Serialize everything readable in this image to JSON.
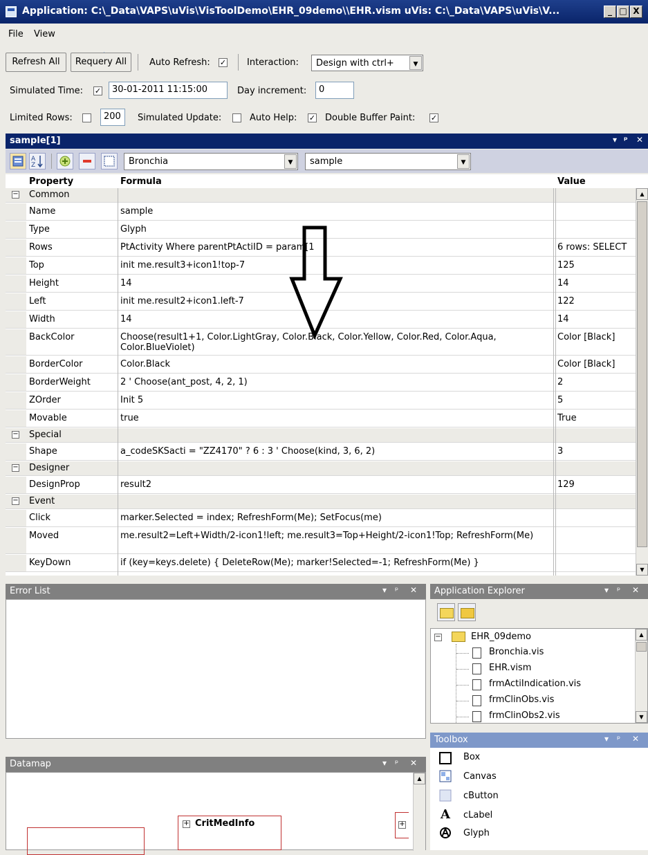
{
  "window": {
    "title": "Application: C:\\_Data\\VAPS\\uVis\\VisToolDemo\\EHR_09demo\\\\EHR.vism    uVis: C:\\_Data\\VAPS\\uVis\\V...",
    "minimize": "_",
    "maximize": "□",
    "close": "X"
  },
  "menu": {
    "file": "File",
    "view": "View",
    "back_icon": "back-arrow-icon",
    "forward_icon": "redo-arrow-icon"
  },
  "toolbar": {
    "refresh_all": "Refresh All",
    "requery_all": "Requery All",
    "auto_refresh_label": "Auto Refresh:",
    "auto_refresh_checked": true,
    "interaction_label": "Interaction:",
    "interaction_value": "Design with ctrl+",
    "simulated_time_label": "Simulated Time:",
    "simulated_time_checked": true,
    "simulated_time_value": "30-01-2011 11:15:00",
    "day_increment_label": "Day increment:",
    "day_increment_value": "0",
    "limited_rows_label": "Limited Rows:",
    "limited_rows_checked": false,
    "limited_rows_value": "200",
    "simulated_update_label": "Simulated Update:",
    "simulated_update_checked": false,
    "auto_help_label": "Auto Help:",
    "auto_help_checked": true,
    "double_buffer_label": "Double Buffer Paint:",
    "double_buffer_checked": true
  },
  "properties_panel": {
    "title": "sample[1]",
    "form_select": "Bronchia",
    "object_select": "sample",
    "columns": {
      "property": "Property",
      "formula": "Formula",
      "value": "Value"
    },
    "rows": [
      {
        "kind": "category",
        "name": "Common"
      },
      {
        "kind": "prop",
        "name": "Name",
        "formula": "sample",
        "value": ""
      },
      {
        "kind": "prop",
        "name": "Type",
        "formula": "Glyph",
        "value": ""
      },
      {
        "kind": "prop",
        "name": "Rows",
        "formula": "PtActivity Where parentPtActiID = param[1",
        "value": "6 rows: SELECT"
      },
      {
        "kind": "prop",
        "name": "Top",
        "formula": "init me.result3+icon1!top-7",
        "value": "125"
      },
      {
        "kind": "prop",
        "name": "Height",
        "formula": "14",
        "value": "14"
      },
      {
        "kind": "prop",
        "name": "Left",
        "formula": "init me.result2+icon1.left-7",
        "value": "122"
      },
      {
        "kind": "prop",
        "name": "Width",
        "formula": "14",
        "value": "14"
      },
      {
        "kind": "prop",
        "name": "BackColor",
        "formula": "Choose(result1+1, Color.LightGray, Color.Black, Color.Yellow, Color.Red, Color.Aqua, Color.BlueViolet)",
        "value": "Color [Black]"
      },
      {
        "kind": "prop",
        "name": "BorderColor",
        "formula": "Color.Black",
        "value": "Color [Black]"
      },
      {
        "kind": "prop",
        "name": "BorderWeight",
        "formula": "2 ' Choose(ant_post, 4, 2, 1)",
        "value": "2"
      },
      {
        "kind": "prop",
        "name": "ZOrder",
        "formula": "Init 5",
        "value": "5"
      },
      {
        "kind": "prop",
        "name": "Movable",
        "formula": "true",
        "value": "True"
      },
      {
        "kind": "category",
        "name": "Special"
      },
      {
        "kind": "prop",
        "name": "Shape",
        "formula": "a_codeSKSacti = \"ZZ4170\" ? 6 : 3 ' Choose(kind, 3, 6, 2)",
        "value": "3"
      },
      {
        "kind": "category",
        "name": "Designer"
      },
      {
        "kind": "prop",
        "name": "DesignProp",
        "formula": "result2",
        "value": "129"
      },
      {
        "kind": "category",
        "name": "Event"
      },
      {
        "kind": "prop",
        "name": "Click",
        "formula": "marker.Selected = index; RefreshForm(Me); SetFocus(me)",
        "value": ""
      },
      {
        "kind": "prop",
        "name": "Moved",
        "formula": "me.result2=Left+Width/2-icon1!left; me.result3=Top+Height/2-icon1!Top; RefreshForm(Me)",
        "value": ""
      },
      {
        "kind": "prop",
        "name": "KeyDown",
        "formula": "if (key=keys.delete) { DeleteRow(Me); marker!Selected=-1; RefreshForm(Me) }",
        "value": ""
      }
    ]
  },
  "error_list": {
    "title": "Error List"
  },
  "app_explorer": {
    "title": "Application Explorer",
    "root": "EHR_09demo",
    "files": [
      "Bronchia.vis",
      "EHR.vism",
      "frmActiIndication.vis",
      "frmClinObs.vis",
      "frmClinObs2.vis"
    ]
  },
  "toolbox": {
    "title": "Toolbox",
    "items": [
      {
        "label": "Box",
        "icon": "box-icon"
      },
      {
        "label": "Canvas",
        "icon": "canvas-icon"
      },
      {
        "label": "cButton",
        "icon": "button-icon"
      },
      {
        "label": "cLabel",
        "icon": "label-icon"
      },
      {
        "label": "Glyph",
        "icon": "glyph-icon"
      }
    ]
  },
  "datamap": {
    "title": "Datamap",
    "node": "CritMedInfo",
    "expand_glyph": "+"
  },
  "panel_controls": {
    "dropdown": "▾",
    "pin": "ᵖ",
    "close": "✕"
  }
}
